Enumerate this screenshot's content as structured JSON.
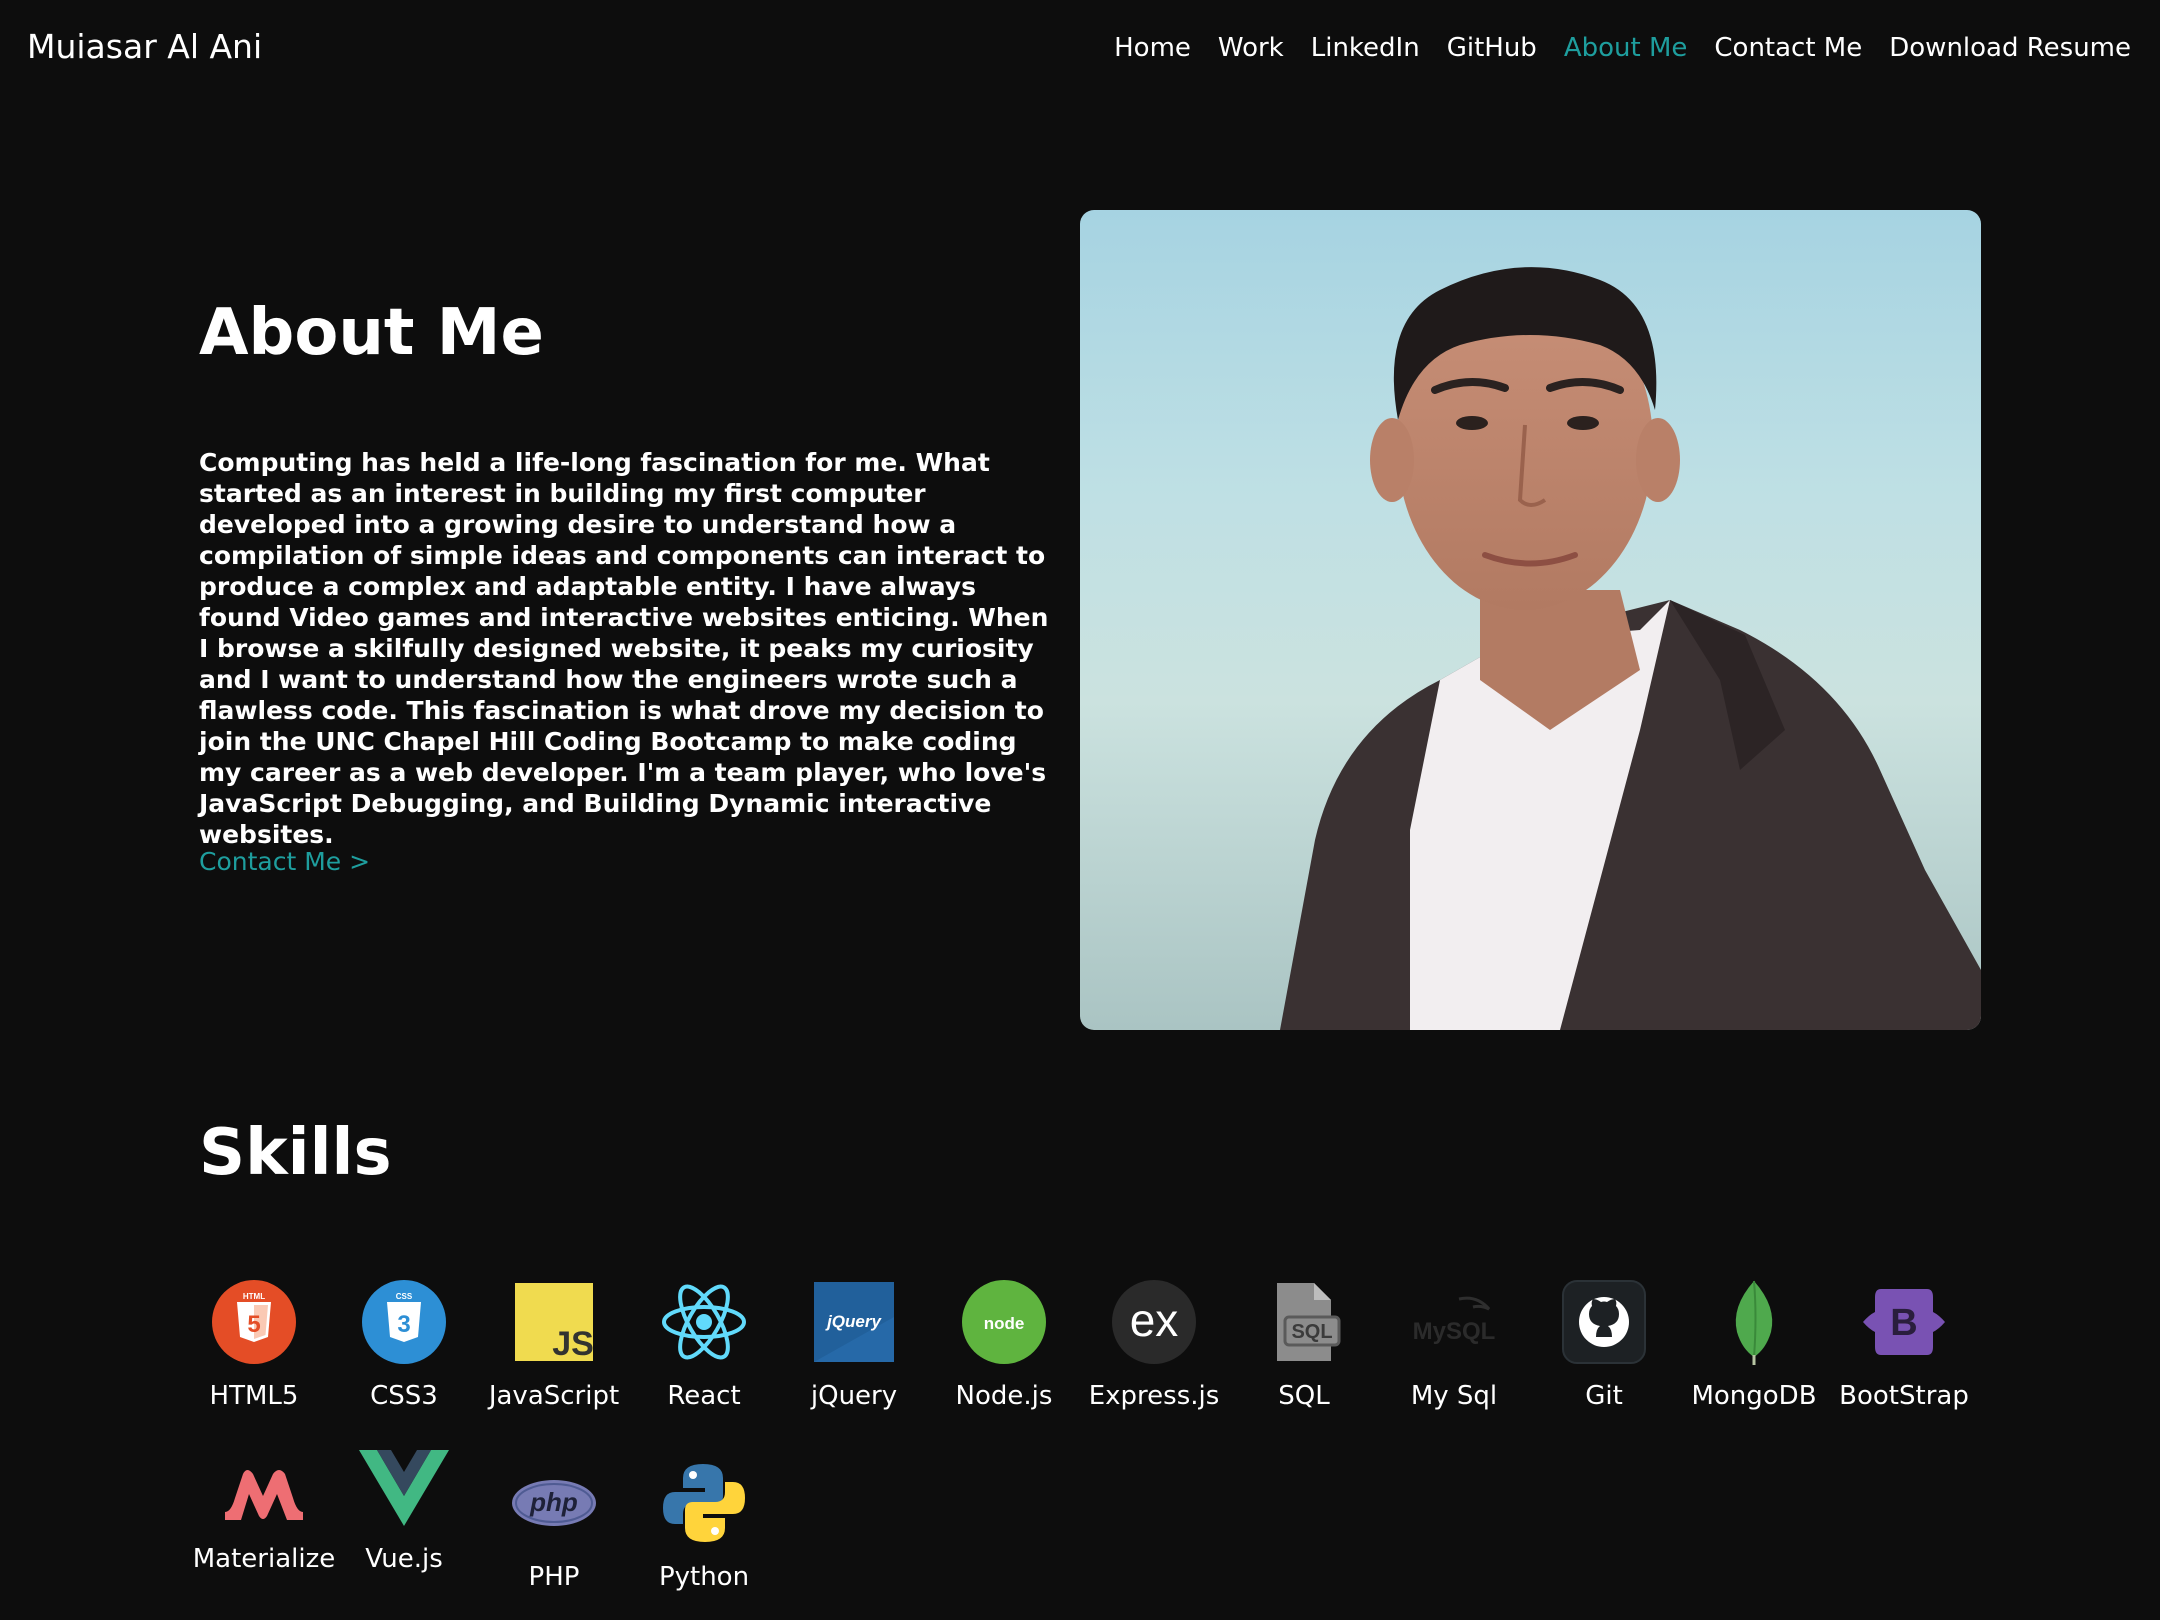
{
  "header": {
    "brand": "Muiasar Al Ani",
    "nav": [
      {
        "label": "Home"
      },
      {
        "label": "Work"
      },
      {
        "label": "LinkedIn"
      },
      {
        "label": "GitHub"
      },
      {
        "label": "About Me"
      },
      {
        "label": "Contact Me"
      },
      {
        "label": "Download Resume"
      }
    ],
    "active_nav": "About Me"
  },
  "about": {
    "title": "About Me",
    "paragraph": "Computing has held a life-long fascination for me. What started as an interest in building my first computer developed into a growing desire to understand how a compilation of simple ideas and components can interact to produce a complex and adaptable entity. I have always found Video games and interactive websites enticing. When I browse a skilfully designed website, it peaks my curiosity and I want to understand how the engineers wrote such a flawless code. This fascination is what drove my decision to join the UNC Chapel Hill Coding Bootcamp to make coding my career as a web developer. I'm a team player, who love's JavaScript Debugging, and Building Dynamic interactive websites.",
    "contact_link": "Contact Me >"
  },
  "skills": {
    "title": "Skills",
    "items": [
      {
        "label": "HTML5",
        "icon": "html5-icon",
        "logo_text": "HTML"
      },
      {
        "label": "CSS3",
        "icon": "css3-icon",
        "logo_text": "CSS"
      },
      {
        "label": "JavaScript",
        "icon": "javascript-icon",
        "logo_text": "JS"
      },
      {
        "label": "React",
        "icon": "react-icon"
      },
      {
        "label": "jQuery",
        "icon": "jquery-icon",
        "logo_text": "jQuery"
      },
      {
        "label": "Node.js",
        "icon": "nodejs-icon",
        "logo_text": "node"
      },
      {
        "label": "Express.js",
        "icon": "expressjs-icon",
        "logo_text": "ex"
      },
      {
        "label": "SQL",
        "icon": "sql-file-icon",
        "logo_text": "SQL"
      },
      {
        "label": "My Sql",
        "icon": "mysql-icon",
        "logo_text": "MySQL"
      },
      {
        "label": "Git",
        "icon": "github-icon"
      },
      {
        "label": "MongoDB",
        "icon": "mongodb-leaf-icon"
      },
      {
        "label": "BootStrap",
        "icon": "bootstrap-icon",
        "logo_text": "B"
      },
      {
        "label": "Materialize",
        "icon": "materialize-icon"
      },
      {
        "label": "Vue.js",
        "icon": "vuejs-icon"
      },
      {
        "label": "PHP",
        "icon": "php-icon",
        "logo_text": "php"
      },
      {
        "label": "Python",
        "icon": "python-icon"
      }
    ]
  },
  "colors": {
    "background": "#0d0d0d",
    "text": "#ffffff",
    "accent": "#1e9e9e"
  }
}
